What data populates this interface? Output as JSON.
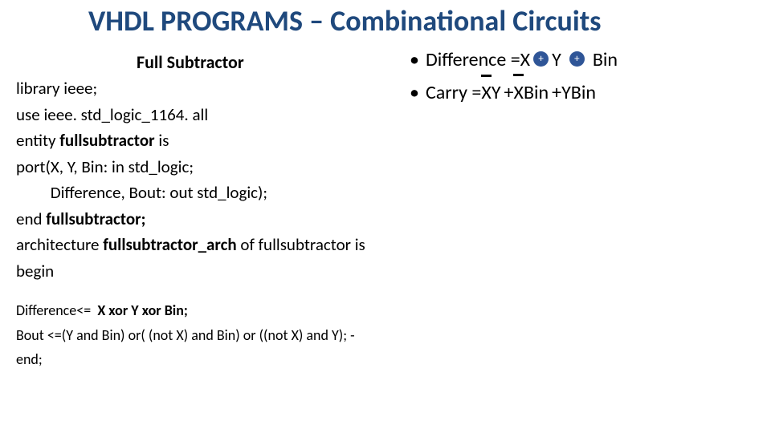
{
  "title": "VHDL PROGRAMS – Combinational Circuits",
  "subtitle": "Full Subtractor",
  "formulas": {
    "diff": {
      "bullet": "•",
      "label": "Difference = ",
      "x": "X",
      "y": "Y",
      "bin": "Bin",
      "plus": "+"
    },
    "carry": {
      "bullet": "•",
      "prefix": "Carry = ",
      "t1_a": "X",
      "t1_b": "Y",
      "plus1": "+ ",
      "t2_a": "X",
      "t2_b": "Bin ",
      "plus2": "+",
      "t3_a": "Y",
      "t3_b": "Bin"
    }
  },
  "code": {
    "l1": "library ieee;",
    "l2": "use ieee. std_logic_1164. all",
    "l3a": "entity ",
    "l3b": "fullsubtractor",
    "l3c": " is",
    "l4": "port(X, Y, Bin: in std_logic;",
    "l5": "         Difference, Bout: out std_logic);",
    "l6a": "end ",
    "l6b": "fullsubtractor;",
    "l7a": "architecture ",
    "l7b": "fullsubtractor_arch",
    "l7c": " of fullsubtractor is",
    "l8": "begin"
  },
  "small": {
    "s1a": "Difference<=  ",
    "s1b": "X xor Y xor Bin;",
    "s2": "Bout <=(Y and Bin) or( (not X) and Bin) or ((not X) and Y); -",
    "s3": "end;"
  }
}
